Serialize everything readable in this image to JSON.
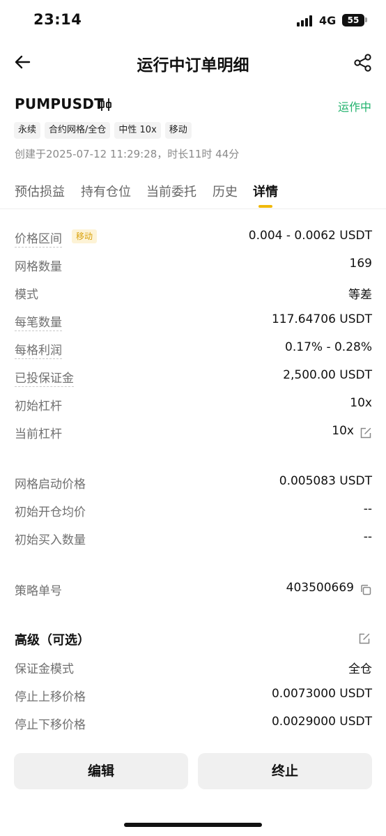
{
  "status_bar": {
    "time": "23:14",
    "network": "4G",
    "battery": "55"
  },
  "header": {
    "title": "运行中订单明细"
  },
  "order": {
    "symbol": "PUMPUSDT",
    "status": "运作中",
    "tags": [
      "永续",
      "合约网格/全仓",
      "中性 10x",
      "移动"
    ],
    "created": "创建于2025-07-12 11:29:28，时长11时 44分"
  },
  "tabs": [
    "预估损益",
    "持有仓位",
    "当前委托",
    "历史",
    "详情"
  ],
  "active_tab": "详情",
  "details": {
    "price_range": {
      "label": "价格区间",
      "badge": "移动",
      "value": "0.004 - 0.0062 USDT"
    },
    "grid_count": {
      "label": "网格数量",
      "value": "169"
    },
    "mode": {
      "label": "模式",
      "value": "等差"
    },
    "per_order_qty": {
      "label": "每笔数量",
      "value": "117.64706 USDT"
    },
    "profit_per_grid": {
      "label": "每格利润",
      "value": "0.17% - 0.28%"
    },
    "margin_invested": {
      "label": "已投保证金",
      "value": "2,500.00 USDT"
    },
    "initial_leverage": {
      "label": "初始杠杆",
      "value": "10x"
    },
    "current_leverage": {
      "label": "当前杠杆",
      "value": "10x"
    }
  },
  "start_info": {
    "start_price": {
      "label": "网格启动价格",
      "value": "0.005083 USDT"
    },
    "initial_avg_price": {
      "label": "初始开仓均价",
      "value": "--"
    },
    "initial_buy_qty": {
      "label": "初始买入数量",
      "value": "--"
    }
  },
  "strategy": {
    "label": "策略单号",
    "value": "403500669"
  },
  "advanced": {
    "title": "高级（可选）",
    "margin_mode": {
      "label": "保证金模式",
      "value": "全仓"
    },
    "stop_upper": {
      "label": "停止上移价格",
      "value": "0.0073000 USDT"
    },
    "stop_lower": {
      "label": "停止下移价格",
      "value": "0.0029000 USDT"
    }
  },
  "buttons": {
    "edit": "编辑",
    "terminate": "终止"
  },
  "colors": {
    "accent": "#f0b90b",
    "running": "#20b26c",
    "badge_bg": "#fdf3d6",
    "badge_text": "#d9a10b"
  }
}
